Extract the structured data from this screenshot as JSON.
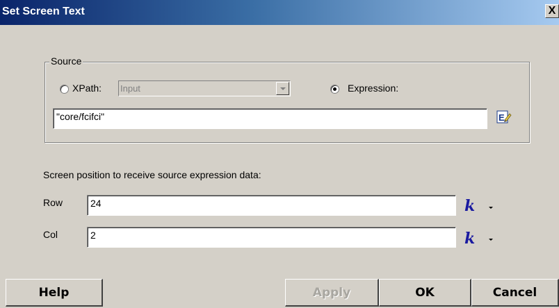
{
  "window": {
    "title": "Set Screen Text",
    "close_label": "X"
  },
  "source": {
    "legend": "Source",
    "xpath_label": "XPath:",
    "xpath_combo_value": "Input",
    "xpath_selected": false,
    "expression_label": "Expression:",
    "expression_selected": true,
    "expression_value": "\"core/fcifci\""
  },
  "position": {
    "caption": "Screen position to receive source expression data:",
    "row_label": "Row",
    "row_value": "24",
    "col_label": "Col",
    "col_value": "2",
    "k_symbol": "k"
  },
  "buttons": {
    "help": "Help",
    "apply": "Apply",
    "ok": "OK",
    "cancel": "Cancel"
  },
  "colors": {
    "title_bar": "#0a246a",
    "dialog_bg": "#d4d0c8",
    "k_icon": "#1a1aa0"
  },
  "icons": {
    "expression_editor": "edit-expression-icon"
  }
}
